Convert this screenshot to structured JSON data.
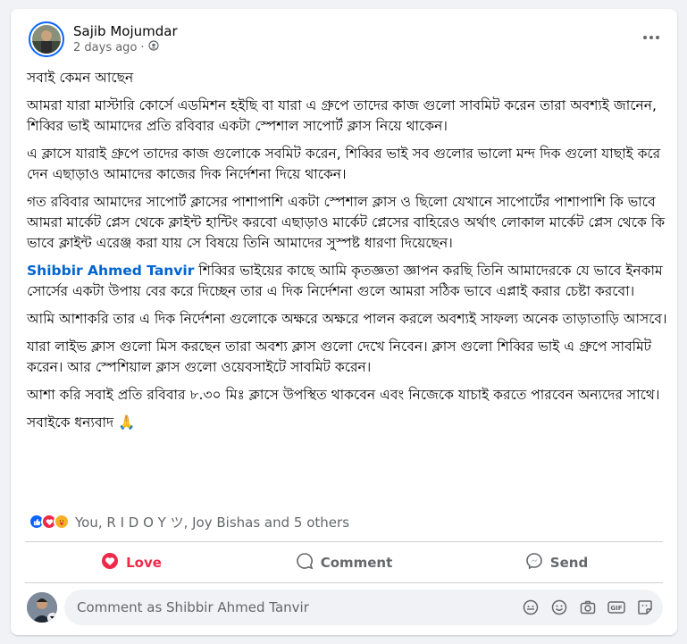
{
  "post": {
    "author": "Sajib Mojumdar",
    "time": "2 days ago",
    "paragraphs": [
      "সবাই কেমন আছেন",
      "আমরা যারা মাস্টারি কোর্সে এডমিশন হইছি বা যারা এ গ্রুপে তাদের কাজ গুলো সাবমিট করেন তারা অবশ্যই জানেন, শিব্বির ভাই আমাদের প্রতি রবিবার একটা স্পেশাল সাপোর্ট ক্লাস নিয়ে থাকেন।",
      "এ ক্লাসে যারাই গ্রুপে তাদের কাজ গুলোকে সবমিট করেন, শিব্বির ভাই সব গুলোর ভালো মন্দ দিক গুলো যাছাই করে দেন এছাড়াও আমাদের কাজের দিক নির্দেশনা দিয়ে থাকেন।",
      "গত রবিবার আমাদের সাপোর্ট ক্লাসের পাশাপাশি একটা স্পেশাল ক্লাস ও ছিলো যেখানে সাপোর্টের পাশাপাশি কি ভাবে আমরা মার্কেট প্লেস থেকে ক্লাইন্ট হান্টিং করবো এছাড়াও মার্কেট প্লেসের বাহিরেও অর্থাৎ লোকাল মার্কেট প্লেস থেকে কি ভাবে ক্লাইন্ট এরেঞ্জ করা যায় সে বিষয়ে তিনি আমাদের সুস্পষ্ট ধারণা দিয়েছেন।"
    ],
    "mention": "Shibbir Ahmed Tanvir",
    "mention_rest": " শিব্বির ভাইয়ের কাছে আমি কৃতজ্ঞতা জ্ঞাপন করছি তিনি আমাদেরকে যে ভাবে ইনকাম সোর্সের একটা উপায় বের করে দিচ্ছেন তার এ দিক নির্দেশনা গুলে আমরা সঠিক ভাবে এপ্লাই করার চেষ্টা করবো।",
    "paragraphs2": [
      "আমি আশাকরি তার এ দিক নির্দেশনা গুলোকে অক্ষরে অক্ষরে পালন করলে অবশ্যই  সাফল্য অনেক তাড়াতাড়ি আসবে।",
      "যারা লাইভ ক্লাস গুলো মিস করছেন তারা অবশ্য ক্লাস গুলো দেখে নিবেন। ক্লাস গুলো শিব্বির ভাই এ গ্রুপে সাবমিট করেন। আর স্পেশিয়াল ক্লাস গুলো ওয়েবসাইটে সাবমিট করেন।",
      "আশা করি সবাই প্রতি রবিবার ৮.৩০ মিঃ ক্লাসে উপস্থিত থাকবেন এবং নিজেকে যাচাই করতে পারবেন অন্যদের সাথে।"
    ],
    "closing": "সবাইকে ধন্যবাদ",
    "closing_emoji": "🙏"
  },
  "reactions": {
    "icons": [
      "like-icon",
      "love-icon",
      "care-icon"
    ],
    "text": "You, R   I   D   O   Y   ツ, Joy Bishas and 5 others"
  },
  "actions": {
    "love": "Love",
    "comment": "Comment",
    "send": "Send"
  },
  "comment_box": {
    "placeholder": "Comment as Shibbir Ahmed Tanvir"
  },
  "colors": {
    "link": "#0064d1",
    "love": "#f02849",
    "like": "#0866ff",
    "muted": "#65676b"
  }
}
